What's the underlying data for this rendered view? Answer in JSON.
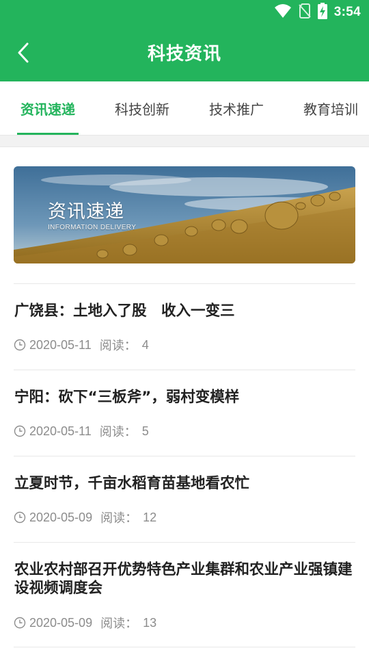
{
  "status_bar": {
    "time": "3:54",
    "icons": [
      "wifi-icon",
      "no-sim-icon",
      "battery-charging-icon"
    ]
  },
  "app_bar": {
    "title": "科技资讯",
    "back_icon": "back-arrow-icon"
  },
  "tabs": [
    {
      "label": "资讯速递",
      "active": true
    },
    {
      "label": "科技创新",
      "active": false
    },
    {
      "label": "技术推广",
      "active": false
    },
    {
      "label": "教育培训",
      "active": false
    }
  ],
  "banner": {
    "title": "资讯速递",
    "subtitle": "INFORMATION DELIVERY"
  },
  "news": [
    {
      "title": "广饶县：土地入了股　收入一变三",
      "date": "2020-05-11",
      "read_label": "阅读：",
      "read_count": "4"
    },
    {
      "title": "宁阳：砍下“三板斧”，弱村变模样",
      "date": "2020-05-11",
      "read_label": "阅读：",
      "read_count": "5"
    },
    {
      "title": "立夏时节，千亩水稻育苗基地看农忙",
      "date": "2020-05-09",
      "read_label": "阅读：",
      "read_count": "12"
    },
    {
      "title": "农业农村部召开优势特色产业集群和农业产业强镇建设视频调度会",
      "date": "2020-05-09",
      "read_label": "阅读：",
      "read_count": "13"
    }
  ],
  "colors": {
    "brand_green": "#23b45c",
    "text_dark": "#222222",
    "meta_gray": "#8c8c8c"
  }
}
